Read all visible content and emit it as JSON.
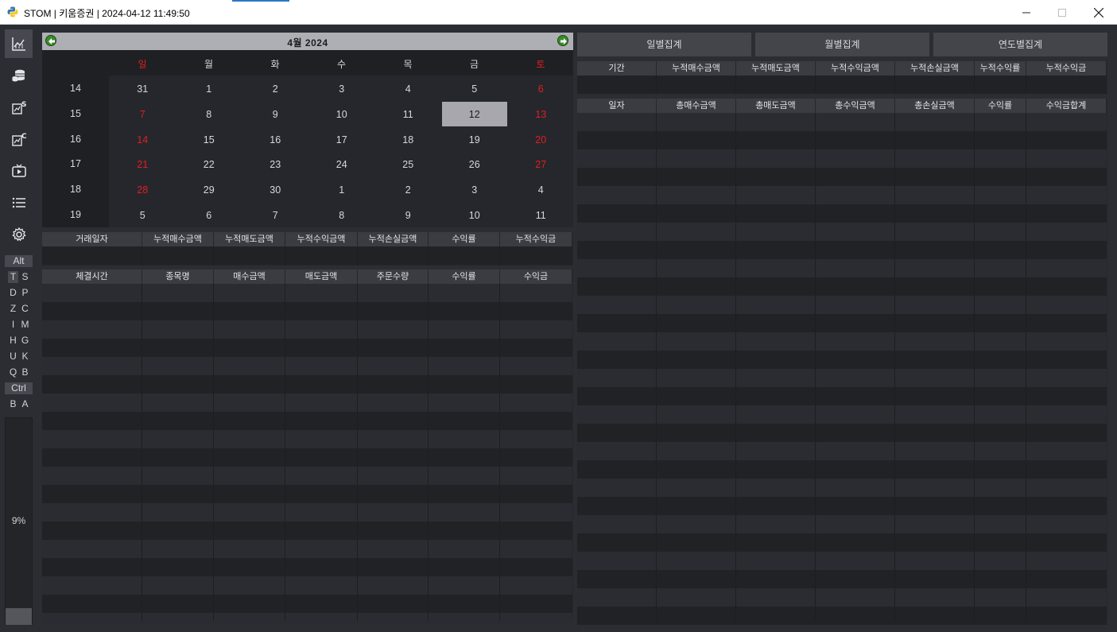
{
  "window": {
    "title": "STOM | 키움증권 | 2024-04-12 11:49:50"
  },
  "sidebar": {
    "icons": [
      "chart-icon",
      "coins-icon",
      "stock-icon",
      "coin-icon",
      "video-icon",
      "list-icon",
      "settings-icon"
    ],
    "alt_label": "Alt",
    "ctrl_label": "Ctrl",
    "key_rows": [
      [
        "T",
        "S"
      ],
      [
        "D",
        "P"
      ],
      [
        "Z",
        "C"
      ],
      [
        "I",
        "M"
      ],
      [
        "H",
        "G"
      ],
      [
        "U",
        "K"
      ],
      [
        "Q",
        "B"
      ]
    ],
    "ctrl_row": [
      "B",
      "A"
    ],
    "cpu_percent": "9%",
    "cpu_fill_fraction": 0.09
  },
  "calendar": {
    "title": "4월   2024",
    "weekdays": [
      "일",
      "월",
      "화",
      "수",
      "목",
      "금",
      "토"
    ],
    "weeks": [
      {
        "num": "14",
        "days": [
          "31",
          "1",
          "2",
          "3",
          "4",
          "5",
          "6"
        ]
      },
      {
        "num": "15",
        "days": [
          "7",
          "8",
          "9",
          "10",
          "11",
          "12",
          "13"
        ]
      },
      {
        "num": "16",
        "days": [
          "14",
          "15",
          "16",
          "17",
          "18",
          "19",
          "20"
        ]
      },
      {
        "num": "17",
        "days": [
          "21",
          "22",
          "23",
          "24",
          "25",
          "26",
          "27"
        ]
      },
      {
        "num": "18",
        "days": [
          "28",
          "29",
          "30",
          "1",
          "2",
          "3",
          "4"
        ]
      },
      {
        "num": "19",
        "days": [
          "5",
          "6",
          "7",
          "8",
          "9",
          "10",
          "11"
        ]
      }
    ],
    "selected": "12",
    "red_color": "#e01f1f"
  },
  "summary_table": {
    "headers": [
      "거래일자",
      "누적매수금액",
      "누적매도금액",
      "누적수익금액",
      "누적손실금액",
      "수익률",
      "누적수익금"
    ]
  },
  "trade_table": {
    "headers": [
      "체결시간",
      "종목명",
      "매수금액",
      "매도금액",
      "주문수량",
      "수익률",
      "수익금"
    ]
  },
  "tabs": [
    "일별집계",
    "월별집계",
    "연도별집계"
  ],
  "period_table": {
    "headers": [
      "기간",
      "누적매수금액",
      "누적매도금액",
      "누적수익금액",
      "누적손실금액",
      "누적수익률",
      "누적수익금"
    ]
  },
  "daily_table": {
    "headers": [
      "일자",
      "총매수금액",
      "총매도금액",
      "총수익금액",
      "총손실금액",
      "수익률",
      "수익금합계"
    ]
  }
}
